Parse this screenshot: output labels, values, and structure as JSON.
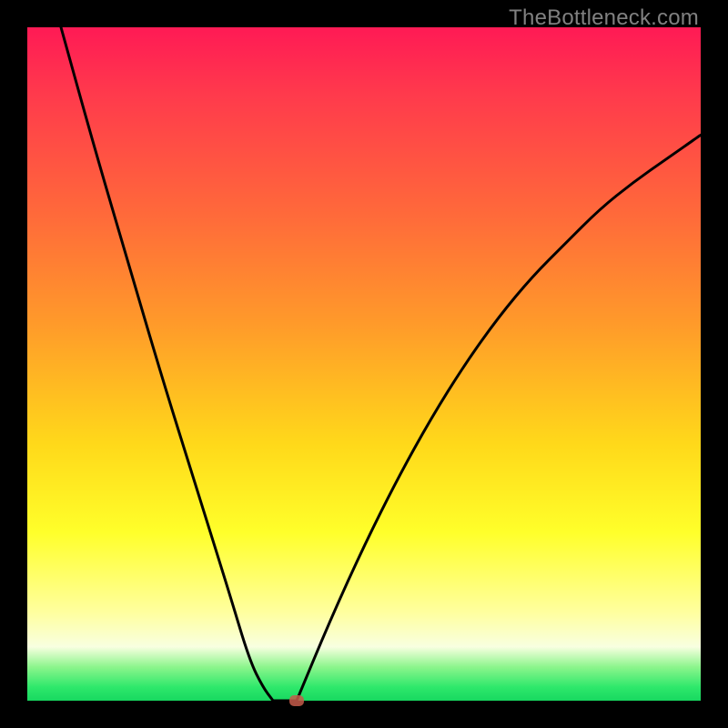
{
  "watermark": "TheBottleneck.com",
  "colors": {
    "frame": "#000000",
    "curve": "#000000",
    "marker": "#c45a4a",
    "gradient_stops": [
      "#ff1a55",
      "#ff3a4c",
      "#ff6a3a",
      "#ff9a2a",
      "#ffd91a",
      "#ffff2a",
      "#ffffa0",
      "#f8ffe0",
      "#8cf58c",
      "#2ee86b",
      "#18d860"
    ]
  },
  "chart_data": {
    "type": "line",
    "title": "",
    "xlabel": "",
    "ylabel": "",
    "xlim": [
      0,
      100
    ],
    "ylim": [
      0,
      100
    ],
    "series": [
      {
        "name": "left-branch",
        "x": [
          5,
          10,
          15,
          20,
          25,
          30,
          33,
          35,
          36.5
        ],
        "values": [
          100,
          82,
          65,
          48,
          32,
          16,
          6,
          2,
          0
        ]
      },
      {
        "name": "floor",
        "x": [
          36.5,
          40
        ],
        "values": [
          0,
          0
        ]
      },
      {
        "name": "right-branch",
        "x": [
          40,
          45,
          50,
          55,
          60,
          65,
          70,
          75,
          80,
          85,
          90,
          95,
          100
        ],
        "values": [
          0,
          12,
          23,
          33,
          42,
          50,
          57,
          63,
          68,
          73,
          77,
          80.5,
          84
        ]
      }
    ],
    "marker": {
      "x": 40,
      "y": 0,
      "label": ""
    }
  }
}
